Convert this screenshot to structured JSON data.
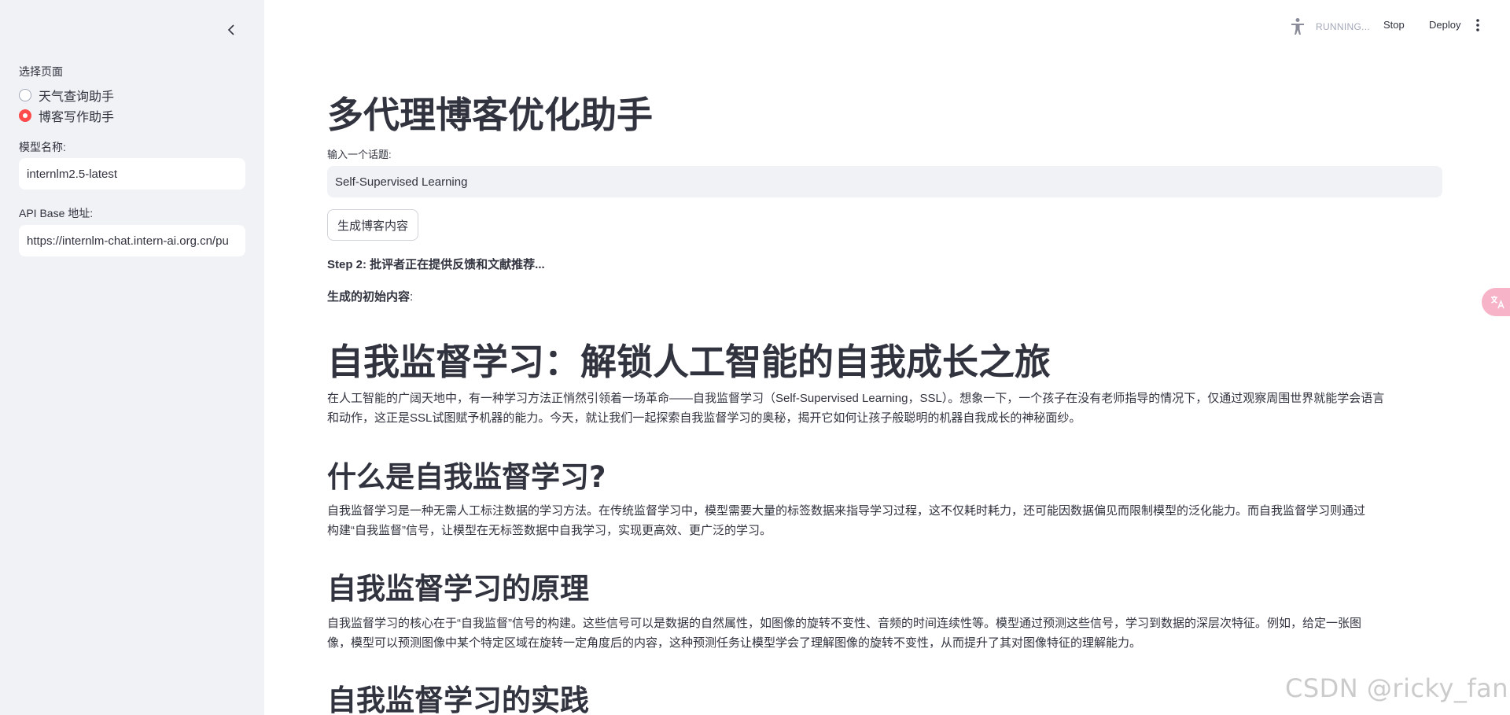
{
  "sidebar": {
    "page_select_label": "选择页面",
    "pages": [
      {
        "label": "天气查询助手",
        "selected": false
      },
      {
        "label": "博客写作助手",
        "selected": true
      }
    ],
    "model_name_label": "模型名称:",
    "model_name_value": "internlm2.5-latest",
    "api_base_label": "API Base 地址:",
    "api_base_value": "https://internlm-chat.intern-ai.org.cn/pu"
  },
  "topbar": {
    "status": "RUNNING...",
    "stop_label": "Stop",
    "deploy_label": "Deploy"
  },
  "main": {
    "title": "多代理博客优化助手",
    "topic_label": "输入一个话题:",
    "topic_value": "Self-Supervised Learning",
    "generate_button": "生成博客内容",
    "step_text": "Step 2: 批评者正在提供反馈和文献推荐...",
    "initial_content_label": "生成的初始内容",
    "initial_content_colon": ":"
  },
  "article": {
    "h1": "自我监督学习：解锁人工智能的自我成长之旅",
    "intro_line1": "在人工智能的广阔天地中，有一种学习方法正悄然引领着一场革命——自我监督学习（Self-Supervised Learning，SSL）。想象一下，一个孩子在没有老师指导的情况下，仅通过观察周围世界就能学会语言",
    "intro_line2": "和动作，这正是SSL试图赋予机器的能力。今天，就让我们一起探索自我监督学习的奥秘，揭开它如何让孩子般聪明的机器自我成长的神秘面纱。",
    "h2_what": "什么是自我监督学习?",
    "what_line1": "自我监督学习是一种无需人工标注数据的学习方法。在传统监督学习中，模型需要大量的标签数据来指导学习过程，这不仅耗时耗力，还可能因数据偏见而限制模型的泛化能力。而自我监督学习则通过",
    "what_line2": "构建“自我监督”信号，让模型在无标签数据中自我学习，实现更高效、更广泛的学习。",
    "h2_principle": "自我监督学习的原理",
    "principle_line1": "自我监督学习的核心在于“自我监督”信号的构建。这些信号可以是数据的自然属性，如图像的旋转不变性、音频的时间连续性等。模型通过预测这些信号，学习到数据的深层次特征。例如，给定一张图",
    "principle_line2": "像，模型可以预测图像中某个特定区域在旋转一定角度后的内容，这种预测任务让模型学会了理解图像的旋转不变性，从而提升了其对图像特征的理解能力。",
    "h2_practice": "自我监督学习的实践"
  },
  "watermark": "CSDN @ricky_fan",
  "icons": {
    "collapse": "chevron-left-icon",
    "running": "running-person-icon",
    "menu": "more-vertical-icon",
    "translate": "translate-icon"
  },
  "colors": {
    "accent": "#ff4b4b",
    "sidebar_bg": "#f0f2f6",
    "text": "#31333f",
    "muted": "#a3a8b8"
  }
}
